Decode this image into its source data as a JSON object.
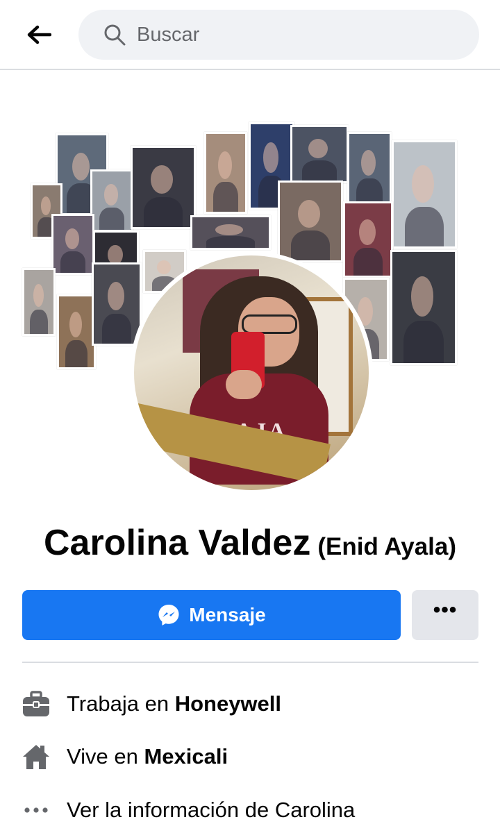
{
  "search": {
    "placeholder": "Buscar"
  },
  "profile": {
    "name": "Carolina Valdez",
    "alternate_name": "(Enid Ayala)"
  },
  "actions": {
    "message_label": "Mensaje",
    "more_label": "•••"
  },
  "info": [
    {
      "icon": "briefcase-icon",
      "prefix": "Trabaja en",
      "value": "Honeywell"
    },
    {
      "icon": "house-icon",
      "prefix": "Vive en",
      "value": "Mexicali"
    },
    {
      "icon": "more-dots-icon",
      "text": "Ver la información de Carolina"
    }
  ],
  "shirt_print": "BAJA",
  "colors": {
    "accent": "#1877f2",
    "secondary_button": "#e4e6eb",
    "search_bg": "#f0f2f5",
    "icon_gray": "#65676b"
  }
}
